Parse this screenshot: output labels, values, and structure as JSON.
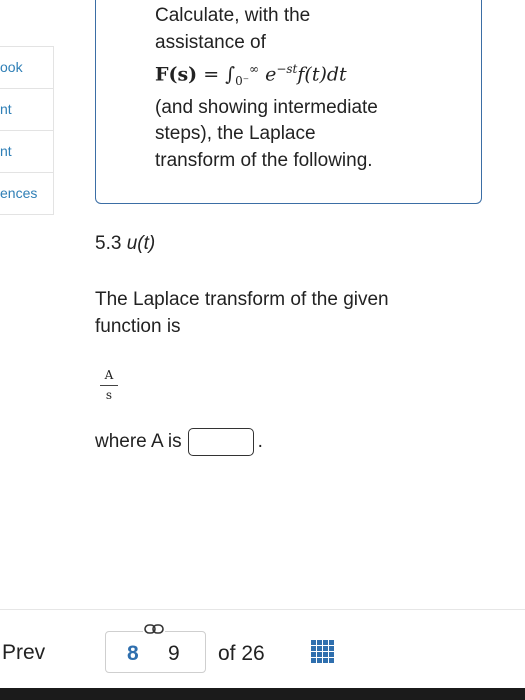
{
  "sidebar": {
    "items": [
      {
        "label": "ook"
      },
      {
        "label": "nt"
      },
      {
        "label": "nt"
      },
      {
        "label": "ences"
      }
    ]
  },
  "question": {
    "line1": "Calculate, with the",
    "line2": "assistance of",
    "formula": {
      "lhs": "F(s)",
      "eq": " = ",
      "integral": "∫",
      "upper": "∞",
      "lower": "0⁻",
      "body": "e",
      "exp": "−st",
      "rest": "f(t)dt"
    },
    "line3": "(and showing intermediate",
    "line4": "steps), the Laplace",
    "line5": "transform of the following."
  },
  "problem": {
    "number": "5.3 ",
    "func": "u(t)"
  },
  "answer": {
    "intro": "The Laplace transform of the given function is",
    "fraction_num": "A",
    "fraction_den": "s",
    "where": "where A is",
    "period": "."
  },
  "pagination": {
    "prev": "Prev",
    "current": "8",
    "next": "9",
    "of": "of 26"
  },
  "colors": {
    "accent": "#2f6fae",
    "sidebar_link": "#2f7fb6",
    "box_border": "#3b6ea5"
  }
}
